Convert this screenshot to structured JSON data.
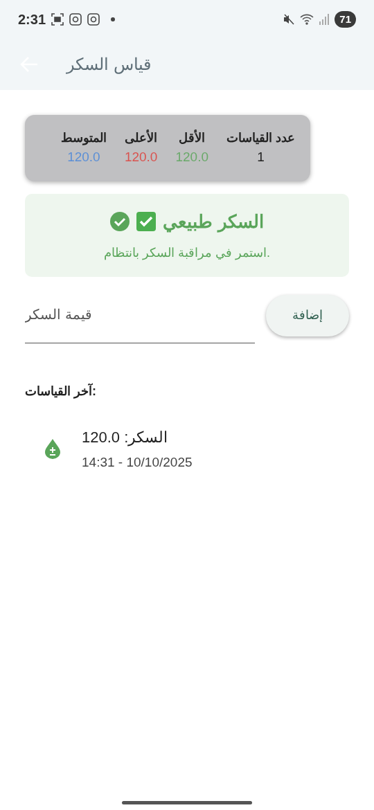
{
  "status_bar": {
    "time": "2:31",
    "battery": "71"
  },
  "app_bar": {
    "title": "قياس السكر"
  },
  "stats": [
    {
      "label": "عدد القياسات",
      "value": "1",
      "color": "#1f1f1f"
    },
    {
      "label": "الأقل",
      "value": "120.0",
      "color": "#6aa96a"
    },
    {
      "label": "الأعلى",
      "value": "120.0",
      "color": "#d9534f"
    },
    {
      "label": "المتوسط",
      "value": "120.0",
      "color": "#5b8fd6"
    }
  ],
  "status_card": {
    "kind": "normal",
    "title": "السكر طبيعي",
    "message": "استمر في مراقبة السكر بانتظام."
  },
  "input": {
    "placeholder": "قيمة السكر"
  },
  "add_button": "إضافة",
  "history_heading": "آخر القياسات:",
  "history": [
    {
      "title": "السكر: 120.0",
      "subtitle": "14:31 - 10/10/2025"
    }
  ]
}
